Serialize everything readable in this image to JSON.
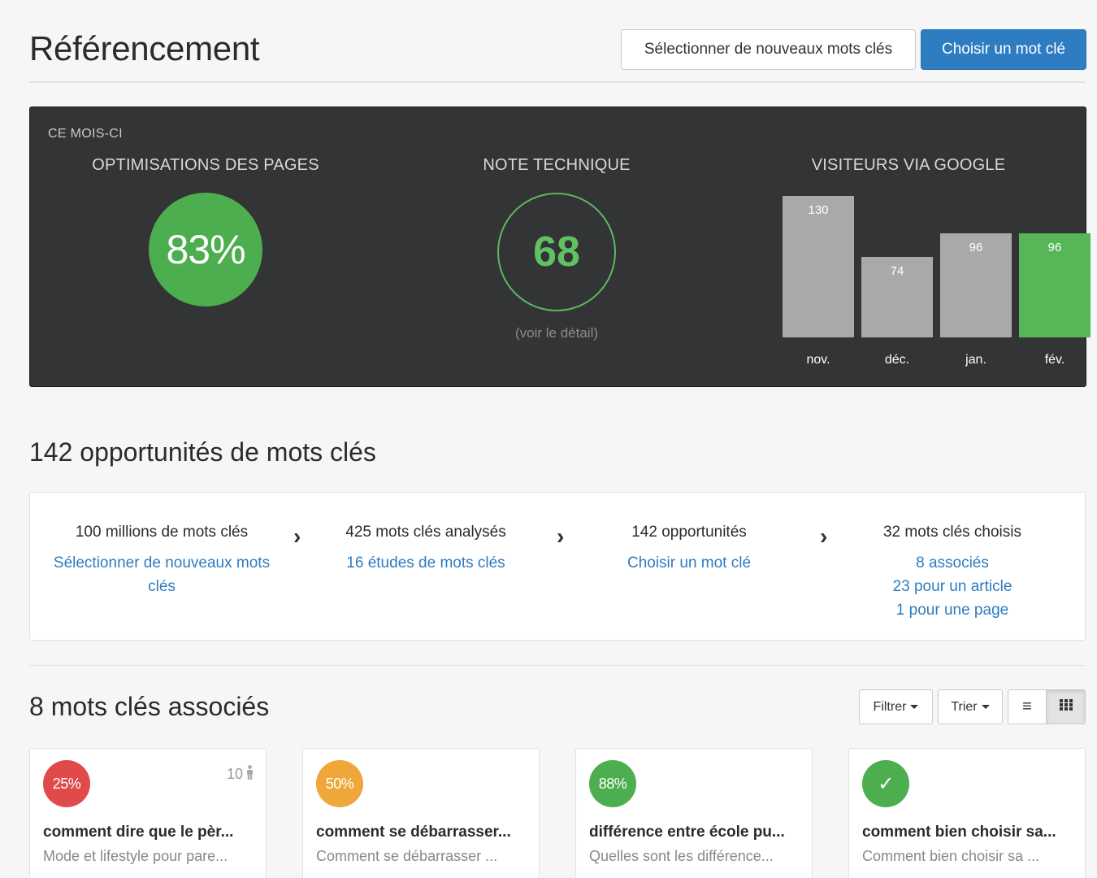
{
  "header": {
    "title": "Référencement",
    "select_button": "Sélectionner de nouveaux mots clés",
    "choose_button": "Choisir un mot clé"
  },
  "stats": {
    "period": "CE MOIS-CI",
    "optimisations": {
      "title": "OPTIMISATIONS DES PAGES",
      "value": "83%"
    },
    "technical": {
      "title": "NOTE TECHNIQUE",
      "value": "68",
      "detail": "(voir le détail)"
    },
    "visitors": {
      "title": "VISITEURS VIA GOOGLE"
    }
  },
  "colors": {
    "accent": "#2e7cc1",
    "green": "#4cae4f",
    "orange": "#f0a73a",
    "red": "#e04a4a",
    "bar_gray": "#a9a9a9",
    "dark_panel": "#333435"
  },
  "chart_data": {
    "type": "bar",
    "title": "VISITEURS VIA GOOGLE",
    "categories": [
      "nov.",
      "déc.",
      "jan.",
      "fév."
    ],
    "values": [
      130,
      74,
      96,
      96
    ],
    "ylim": [
      0,
      130
    ],
    "highlight": "fév.",
    "grid": false
  },
  "opportunities": {
    "title": "142 opportunités de mots clés",
    "steps": [
      {
        "head": "100 millions de mots clés",
        "links": [
          "Sélectionner de nouveaux mots clés"
        ]
      },
      {
        "head": "425 mots clés analysés",
        "links": [
          "16 études de mots clés"
        ]
      },
      {
        "head": "142 opportunités",
        "links": [
          "Choisir un mot clé"
        ]
      },
      {
        "head": "32 mots clés choisis",
        "links": [
          "8 associés",
          "23 pour un article",
          "1 pour une page"
        ]
      }
    ],
    "arrow": "›"
  },
  "keywords": {
    "title": "8 mots clés associés",
    "filter": "Filtrer",
    "sort": "Trier",
    "list_icon": "≡",
    "grid_icon": "▦",
    "cards": [
      {
        "score": "25%",
        "color": "red",
        "people": "10",
        "title": "comment dire que le pèr...",
        "subtitle": "Mode et lifestyle pour pare..."
      },
      {
        "score": "50%",
        "color": "orange",
        "title": "comment se débarrasser...",
        "subtitle": "Comment se débarrasser ..."
      },
      {
        "score": "88%",
        "color": "green",
        "title": "différence entre école pu...",
        "subtitle": "Quelles sont les différence..."
      },
      {
        "score": "✓",
        "color": "green",
        "title": "comment bien choisir sa...",
        "subtitle": "Comment bien choisir sa ..."
      }
    ]
  }
}
